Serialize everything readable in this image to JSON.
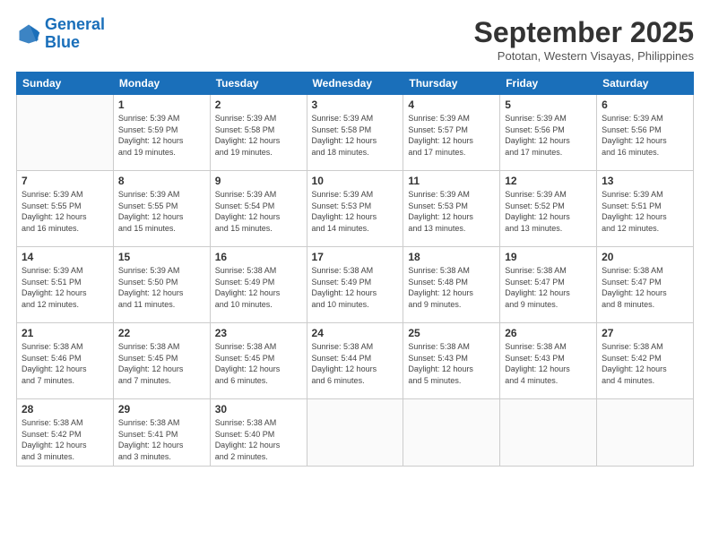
{
  "header": {
    "logo_line1": "General",
    "logo_line2": "Blue",
    "month": "September 2025",
    "location": "Pototan, Western Visayas, Philippines"
  },
  "weekdays": [
    "Sunday",
    "Monday",
    "Tuesday",
    "Wednesday",
    "Thursday",
    "Friday",
    "Saturday"
  ],
  "weeks": [
    [
      {
        "day": "",
        "info": ""
      },
      {
        "day": "1",
        "info": "Sunrise: 5:39 AM\nSunset: 5:59 PM\nDaylight: 12 hours\nand 19 minutes."
      },
      {
        "day": "2",
        "info": "Sunrise: 5:39 AM\nSunset: 5:58 PM\nDaylight: 12 hours\nand 19 minutes."
      },
      {
        "day": "3",
        "info": "Sunrise: 5:39 AM\nSunset: 5:58 PM\nDaylight: 12 hours\nand 18 minutes."
      },
      {
        "day": "4",
        "info": "Sunrise: 5:39 AM\nSunset: 5:57 PM\nDaylight: 12 hours\nand 17 minutes."
      },
      {
        "day": "5",
        "info": "Sunrise: 5:39 AM\nSunset: 5:56 PM\nDaylight: 12 hours\nand 17 minutes."
      },
      {
        "day": "6",
        "info": "Sunrise: 5:39 AM\nSunset: 5:56 PM\nDaylight: 12 hours\nand 16 minutes."
      }
    ],
    [
      {
        "day": "7",
        "info": "Sunrise: 5:39 AM\nSunset: 5:55 PM\nDaylight: 12 hours\nand 16 minutes."
      },
      {
        "day": "8",
        "info": "Sunrise: 5:39 AM\nSunset: 5:55 PM\nDaylight: 12 hours\nand 15 minutes."
      },
      {
        "day": "9",
        "info": "Sunrise: 5:39 AM\nSunset: 5:54 PM\nDaylight: 12 hours\nand 15 minutes."
      },
      {
        "day": "10",
        "info": "Sunrise: 5:39 AM\nSunset: 5:53 PM\nDaylight: 12 hours\nand 14 minutes."
      },
      {
        "day": "11",
        "info": "Sunrise: 5:39 AM\nSunset: 5:53 PM\nDaylight: 12 hours\nand 13 minutes."
      },
      {
        "day": "12",
        "info": "Sunrise: 5:39 AM\nSunset: 5:52 PM\nDaylight: 12 hours\nand 13 minutes."
      },
      {
        "day": "13",
        "info": "Sunrise: 5:39 AM\nSunset: 5:51 PM\nDaylight: 12 hours\nand 12 minutes."
      }
    ],
    [
      {
        "day": "14",
        "info": "Sunrise: 5:39 AM\nSunset: 5:51 PM\nDaylight: 12 hours\nand 12 minutes."
      },
      {
        "day": "15",
        "info": "Sunrise: 5:39 AM\nSunset: 5:50 PM\nDaylight: 12 hours\nand 11 minutes."
      },
      {
        "day": "16",
        "info": "Sunrise: 5:38 AM\nSunset: 5:49 PM\nDaylight: 12 hours\nand 10 minutes."
      },
      {
        "day": "17",
        "info": "Sunrise: 5:38 AM\nSunset: 5:49 PM\nDaylight: 12 hours\nand 10 minutes."
      },
      {
        "day": "18",
        "info": "Sunrise: 5:38 AM\nSunset: 5:48 PM\nDaylight: 12 hours\nand 9 minutes."
      },
      {
        "day": "19",
        "info": "Sunrise: 5:38 AM\nSunset: 5:47 PM\nDaylight: 12 hours\nand 9 minutes."
      },
      {
        "day": "20",
        "info": "Sunrise: 5:38 AM\nSunset: 5:47 PM\nDaylight: 12 hours\nand 8 minutes."
      }
    ],
    [
      {
        "day": "21",
        "info": "Sunrise: 5:38 AM\nSunset: 5:46 PM\nDaylight: 12 hours\nand 7 minutes."
      },
      {
        "day": "22",
        "info": "Sunrise: 5:38 AM\nSunset: 5:45 PM\nDaylight: 12 hours\nand 7 minutes."
      },
      {
        "day": "23",
        "info": "Sunrise: 5:38 AM\nSunset: 5:45 PM\nDaylight: 12 hours\nand 6 minutes."
      },
      {
        "day": "24",
        "info": "Sunrise: 5:38 AM\nSunset: 5:44 PM\nDaylight: 12 hours\nand 6 minutes."
      },
      {
        "day": "25",
        "info": "Sunrise: 5:38 AM\nSunset: 5:43 PM\nDaylight: 12 hours\nand 5 minutes."
      },
      {
        "day": "26",
        "info": "Sunrise: 5:38 AM\nSunset: 5:43 PM\nDaylight: 12 hours\nand 4 minutes."
      },
      {
        "day": "27",
        "info": "Sunrise: 5:38 AM\nSunset: 5:42 PM\nDaylight: 12 hours\nand 4 minutes."
      }
    ],
    [
      {
        "day": "28",
        "info": "Sunrise: 5:38 AM\nSunset: 5:42 PM\nDaylight: 12 hours\nand 3 minutes."
      },
      {
        "day": "29",
        "info": "Sunrise: 5:38 AM\nSunset: 5:41 PM\nDaylight: 12 hours\nand 3 minutes."
      },
      {
        "day": "30",
        "info": "Sunrise: 5:38 AM\nSunset: 5:40 PM\nDaylight: 12 hours\nand 2 minutes."
      },
      {
        "day": "",
        "info": ""
      },
      {
        "day": "",
        "info": ""
      },
      {
        "day": "",
        "info": ""
      },
      {
        "day": "",
        "info": ""
      }
    ]
  ]
}
